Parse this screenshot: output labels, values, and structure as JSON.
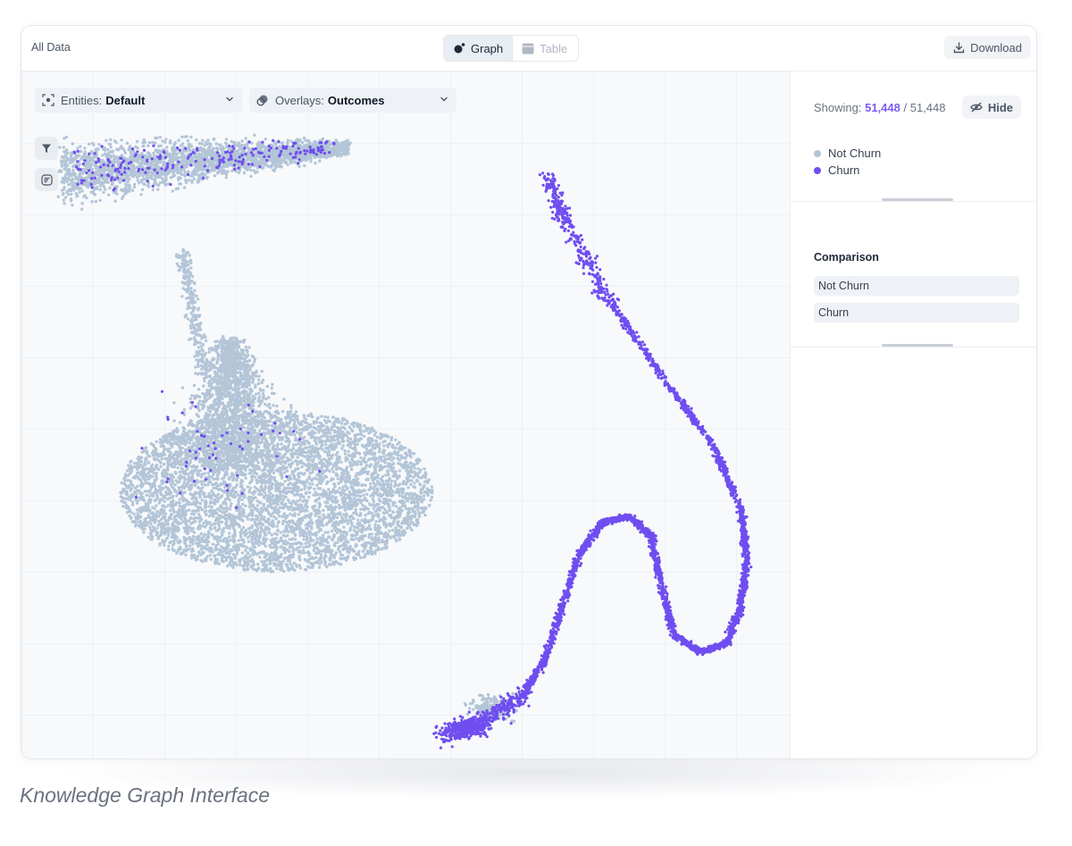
{
  "app": {
    "breadcrumb": "All Data"
  },
  "view_toggle": {
    "graph_label": "Graph",
    "table_label": "Table",
    "active": "Graph"
  },
  "toolbar": {
    "download_label": "Download"
  },
  "filters": {
    "entities": {
      "label": "Entities:",
      "value": "Default"
    },
    "overlays": {
      "label": "Overlays:",
      "value": "Outcomes"
    }
  },
  "side_tools": [
    "filter-icon",
    "list-filter-icon"
  ],
  "panel": {
    "showing_label": "Showing:",
    "showing_count": "51,448",
    "showing_total": "/ 51,448",
    "hide_label": "Hide",
    "legend": [
      {
        "label": "Not Churn",
        "color": "#b3c5d7"
      },
      {
        "label": "Churn",
        "color": "#6f4ef0"
      }
    ],
    "comparison_title": "Comparison",
    "comparison_items": [
      "Not Churn",
      "Churn"
    ]
  },
  "colors": {
    "not_churn": "#b3c5d7",
    "churn": "#6f4ef0",
    "accent": "#7c5cf5"
  },
  "caption": "Knowledge Graph Interface"
}
